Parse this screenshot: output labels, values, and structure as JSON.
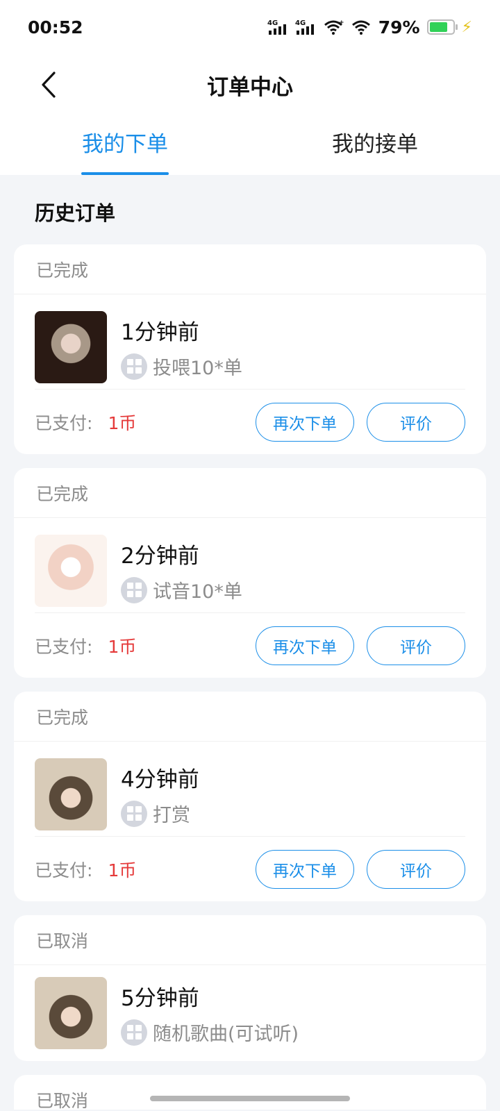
{
  "status_bar": {
    "time": "00:52",
    "signal_1": "4G",
    "signal_2": "4G",
    "battery": "79%",
    "battery_level": 0.79
  },
  "header": {
    "title": "订单中心"
  },
  "tabs": [
    {
      "label": "我的下单",
      "active": true
    },
    {
      "label": "我的接单",
      "active": false
    }
  ],
  "section": {
    "title": "历史订单"
  },
  "orders": [
    {
      "status": "已完成",
      "time": "1分钟前",
      "service": "投喂10*单",
      "paid_label": "已支付:",
      "amount": "1币",
      "reorder_label": "再次下单",
      "review_label": "评价"
    },
    {
      "status": "已完成",
      "time": "2分钟前",
      "service": "试音10*单",
      "paid_label": "已支付:",
      "amount": "1币",
      "reorder_label": "再次下单",
      "review_label": "评价"
    },
    {
      "status": "已完成",
      "time": "4分钟前",
      "service": "打赏",
      "paid_label": "已支付:",
      "amount": "1币",
      "reorder_label": "再次下单",
      "review_label": "评价"
    },
    {
      "status": "已取消",
      "time": "5分钟前",
      "service": "随机歌曲(可试听)"
    },
    {
      "status": "已取消"
    }
  ],
  "colors": {
    "accent": "#1a8ee8",
    "amount": "#e53a3a",
    "background": "#f3f5f8"
  }
}
